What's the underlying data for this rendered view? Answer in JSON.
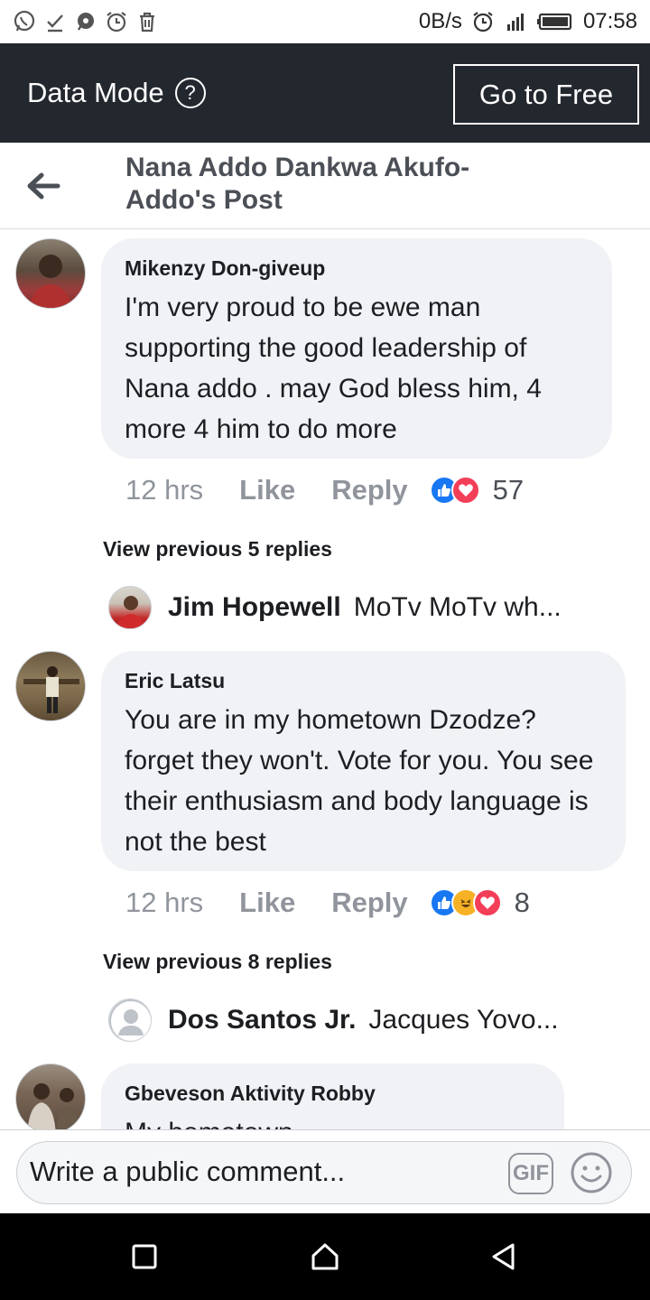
{
  "status_bar": {
    "speed": "0B/s",
    "time": "07:58"
  },
  "data_mode": {
    "title": "Data Mode",
    "help_symbol": "?",
    "go_free_label": "Go to Free"
  },
  "header": {
    "title": "Nana Addo Dankwa Akufo-Addo's Post"
  },
  "comments": [
    {
      "author": "Mikenzy Don-giveup",
      "text": "I'm very proud to be ewe man supporting the good leadership of Nana addo . may God bless him, 4 more 4 him to do more",
      "time": "12 hrs",
      "like_label": "Like",
      "reply_label": "Reply",
      "reactions": [
        "like",
        "love"
      ],
      "reaction_count": "57",
      "view_previous": "View previous 5 replies",
      "reply_preview": {
        "author": "Jim Hopewell",
        "text": "MoTv MoTv wh..."
      }
    },
    {
      "author": "Eric Latsu",
      "text": "You are in my hometown Dzodze? forget they won't. Vote for you. You see their enthusiasm and body language is not the best",
      "time": "12 hrs",
      "like_label": "Like",
      "reply_label": "Reply",
      "reactions": [
        "like",
        "haha",
        "love"
      ],
      "reaction_count": "8",
      "view_previous": "View previous 8 replies",
      "reply_preview": {
        "author": "Dos Santos Jr.",
        "text": "Jacques Yovo..."
      }
    },
    {
      "author": "Gbeveson Aktivity Robby",
      "text": "My hometown"
    }
  ],
  "composer": {
    "placeholder": "Write a public comment...",
    "gif_label": "GIF"
  },
  "colors": {
    "data_mode_bg": "#23272e",
    "bubble_bg": "#f0f2f5",
    "like_blue": "#1877f2",
    "love_red": "#f33e58",
    "haha_yellow": "#f7b125",
    "meta_gray": "#90949c"
  }
}
